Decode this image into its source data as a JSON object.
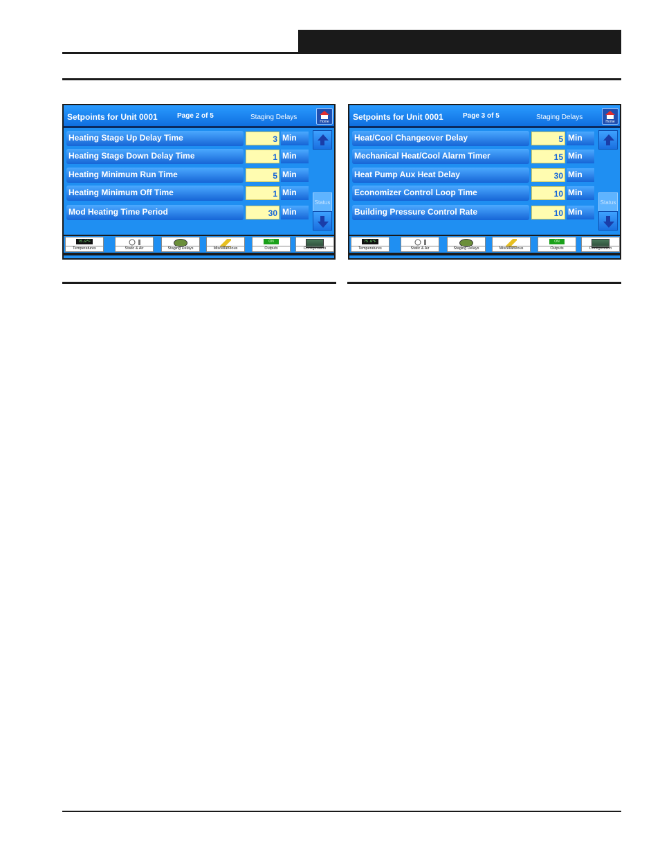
{
  "panels": [
    {
      "title": "Setpoints for Unit 0001",
      "page": "Page 2 of 5",
      "section": "Staging Delays",
      "home_label": "Home",
      "status_label": "Status",
      "rows": [
        {
          "name": "Heating Stage Up Delay Time",
          "value": "3",
          "unit": "Min"
        },
        {
          "name": "Heating Stage Down Delay Time",
          "value": "1",
          "unit": "Min"
        },
        {
          "name": "Heating Minimum Run Time",
          "value": "5",
          "unit": "Min"
        },
        {
          "name": "Heating Minimum Off Time",
          "value": "1",
          "unit": "Min"
        },
        {
          "name": "Mod Heating Time Period",
          "value": "30",
          "unit": "Min"
        }
      ]
    },
    {
      "title": "Setpoints for Unit 0001",
      "page": "Page 3 of 5",
      "section": "Staging Delays",
      "home_label": "Home",
      "status_label": "Status",
      "rows": [
        {
          "name": "Heat/Cool Changeover Delay",
          "value": "5",
          "unit": "Min"
        },
        {
          "name": "Mechanical Heat/Cool Alarm Timer",
          "value": "15",
          "unit": "Min"
        },
        {
          "name": "Heat Pump Aux Heat Delay",
          "value": "30",
          "unit": "Min"
        },
        {
          "name": "Economizer Control Loop Time",
          "value": "10",
          "unit": "Min"
        },
        {
          "name": "Building Pressure Control Rate",
          "value": "10",
          "unit": "Min"
        }
      ]
    }
  ],
  "tabs": [
    {
      "label": "Temperatures",
      "icon": "display-icon",
      "readout": "75.8°F"
    },
    {
      "label": "Static & Air",
      "icon": "fan-icon"
    },
    {
      "label": "Staging Delays",
      "icon": "staging-icon"
    },
    {
      "label": "Miscellaneous",
      "icon": "misc-icon"
    },
    {
      "label": "Outputs",
      "icon": "on-indicator-icon",
      "readout": "ON"
    },
    {
      "label": "Configuration",
      "icon": "board-icon"
    }
  ],
  "colors": {
    "panel_blue": "#1f8ff2",
    "value_bg": "#fffcb0",
    "value_text": "#1666d8"
  }
}
